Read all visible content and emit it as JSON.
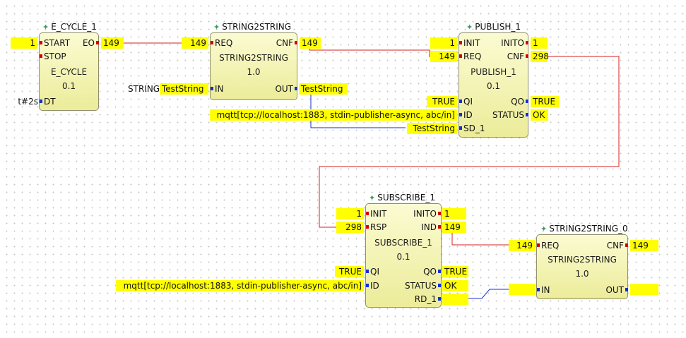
{
  "e_cycle": {
    "instance": "E_CYCLE_1",
    "type": "E_CYCLE",
    "version": "0.1",
    "in_events": [
      "START",
      "STOP"
    ],
    "out_events": [
      "EO"
    ],
    "in_data": [
      "DT"
    ],
    "start_value": "1",
    "eo_value": "149",
    "dt_value": "t#2s"
  },
  "string2string": {
    "instance": "STRING2STRING",
    "type": "STRING2STRING",
    "version": "1.0",
    "in_event": "REQ",
    "out_event": "CNF",
    "in_data": "IN",
    "out_data": "OUT",
    "req_value": "149",
    "cnf_value": "149",
    "in_value": "TestString",
    "in_prefix": "STRING",
    "out_value": "TestString"
  },
  "publish": {
    "instance": "PUBLISH_1",
    "type": "PUBLISH_1",
    "version": "0.1",
    "in_events": [
      "INIT",
      "REQ"
    ],
    "out_events": [
      "INITO",
      "CNF"
    ],
    "in_data": [
      "QI",
      "ID",
      "SD_1"
    ],
    "out_data": [
      "QO",
      "STATUS"
    ],
    "init_value": "1",
    "req_value": "149",
    "inito_value": "1",
    "cnf_value": "298",
    "qi_value": "TRUE",
    "id_value": "mqtt[tcp://localhost:1883, stdin-publisher-async, abc/in]",
    "sd_value": "TestString",
    "qo_value": "TRUE",
    "status_value": "OK"
  },
  "subscribe": {
    "instance": "SUBSCRIBE_1",
    "type": "SUBSCRIBE_1",
    "version": "0.1",
    "in_events": [
      "INIT",
      "RSP"
    ],
    "out_events": [
      "INITO",
      "IND"
    ],
    "in_data": [
      "QI",
      "ID"
    ],
    "out_data": [
      "QO",
      "STATUS",
      "RD_1"
    ],
    "init_value": "1",
    "rsp_value": "298",
    "inito_value": "1",
    "ind_value": "149",
    "qi_value": "TRUE",
    "id_value": "mqtt[tcp://localhost:1883, stdin-publisher-async, abc/in]",
    "qo_value": "TRUE",
    "status_value": "OK"
  },
  "string2string_0": {
    "instance": "STRING2STRING_0",
    "type": "STRING2STRING",
    "version": "1.0",
    "in_event": "REQ",
    "out_event": "CNF",
    "in_data": "IN",
    "out_data": "OUT",
    "req_value": "149",
    "cnf_value": "149"
  },
  "colors": {
    "event_wire": "#d42020",
    "data_wire": "#1a2fc8",
    "value_bg": "#ffff00",
    "block_fill": "#f3f3b4"
  }
}
